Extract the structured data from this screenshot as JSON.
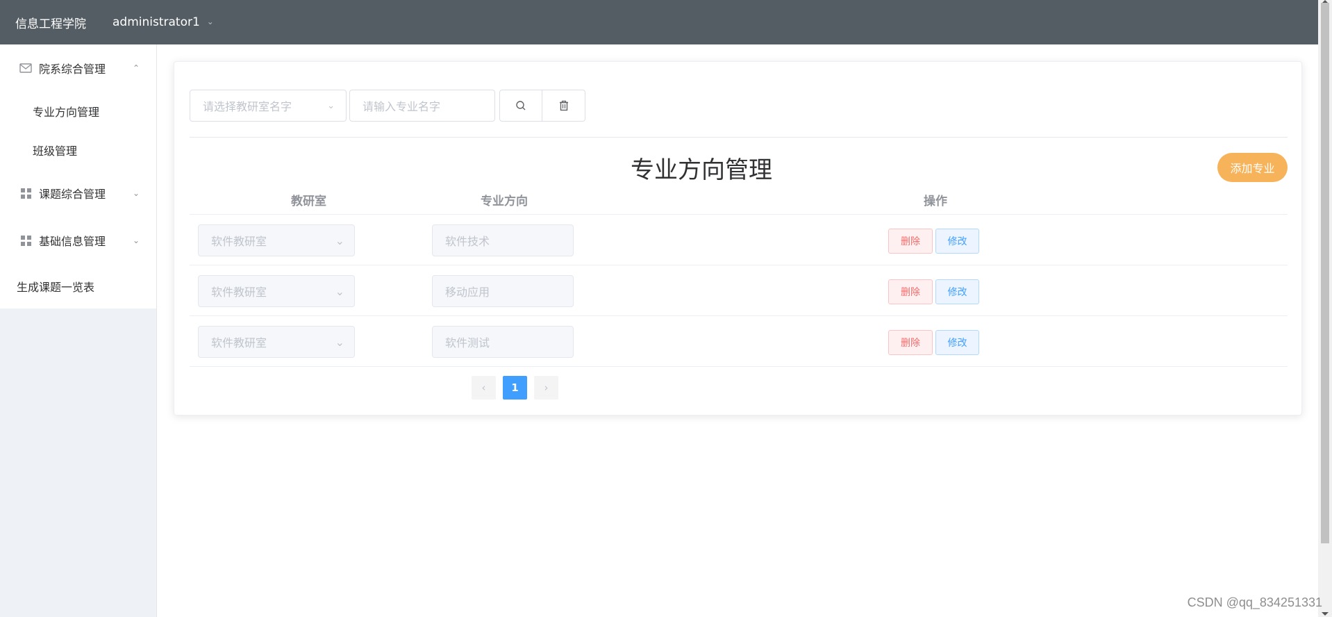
{
  "header": {
    "brand": "信息工程学院",
    "user": "administrator1"
  },
  "sidebar": {
    "groups": [
      {
        "label": "院系综合管理",
        "icon": "mail-icon",
        "expanded": true,
        "items": [
          {
            "label": "专业方向管理"
          },
          {
            "label": "班级管理"
          }
        ]
      },
      {
        "label": "课题综合管理",
        "icon": "grid-icon",
        "expanded": false
      },
      {
        "label": "基础信息管理",
        "icon": "grid-icon",
        "expanded": false
      }
    ],
    "bottom_item": "生成课题一览表"
  },
  "search": {
    "room_placeholder": "请选择教研室名字",
    "major_placeholder": "请输入专业名字"
  },
  "title": "专业方向管理",
  "add_button": "添加专业",
  "table": {
    "columns": [
      "教研室",
      "专业方向",
      "操作"
    ],
    "rows": [
      {
        "room": "软件教研室",
        "major": "软件技术",
        "delete": "删除",
        "edit": "修改"
      },
      {
        "room": "软件教研室",
        "major": "移动应用",
        "delete": "删除",
        "edit": "修改"
      },
      {
        "room": "软件教研室",
        "major": "软件测试",
        "delete": "删除",
        "edit": "修改"
      }
    ]
  },
  "pagination": {
    "current": "1"
  },
  "watermark": "CSDN @qq_834251331",
  "colors": {
    "header": "#545c64",
    "primary": "#409eff",
    "accent": "#f7b35a",
    "danger": "#f56c6c"
  }
}
